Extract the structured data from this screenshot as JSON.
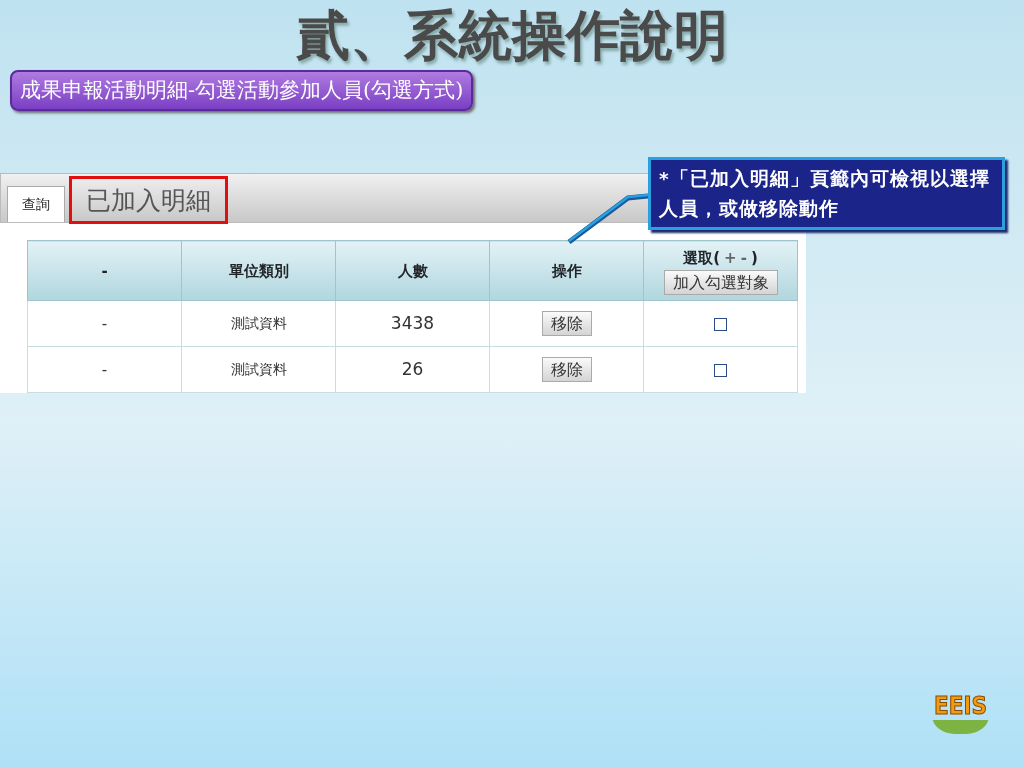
{
  "slide_title": "貳、系統操作說明",
  "subtitle": "成果申報活動明細-勾選活動參加人員(勾選方式)",
  "callout": "*「已加入明細」頁籤內可檢視以選擇人員，或做移除動作",
  "tabs": [
    {
      "label": "查詢",
      "selected": true,
      "highlighted": false
    },
    {
      "label": "已加入明細",
      "selected": false,
      "highlighted": true
    }
  ],
  "table": {
    "columns": [
      "-",
      "單位類別",
      "人數",
      "操作"
    ],
    "select_column": {
      "label": "選取(",
      "plus": "+",
      "minus": "-",
      "close": ")",
      "button": "加入勾選對象"
    },
    "rows": [
      {
        "cells": [
          "-",
          "測試資料",
          "3438"
        ],
        "action": "移除",
        "checked": false
      },
      {
        "cells": [
          "-",
          "測試資料",
          "26"
        ],
        "action": "移除",
        "checked": false
      }
    ]
  },
  "logo": "EEIS"
}
